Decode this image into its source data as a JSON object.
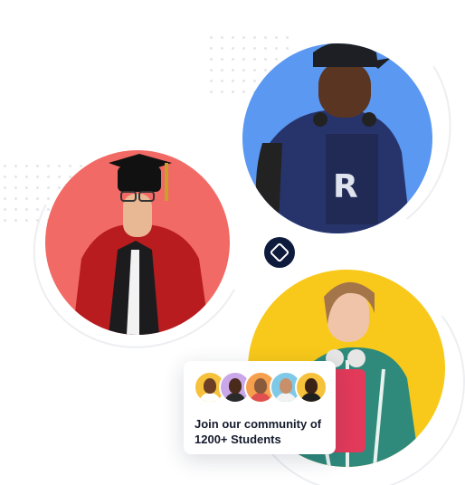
{
  "community_card": {
    "line1": "Join our community of",
    "line2": "1200+ Students",
    "avatar_colors": [
      "#f6c13b",
      "#c9a7e8",
      "#f6a04d",
      "#7fc9e8",
      "#f6c13b"
    ]
  },
  "circles": {
    "red": "#f26a65",
    "blue": "#5b98f2",
    "yellow": "#f8c91a"
  },
  "center_badge_color": "#0e1b3d",
  "icons": [
    "diamond-icon"
  ]
}
